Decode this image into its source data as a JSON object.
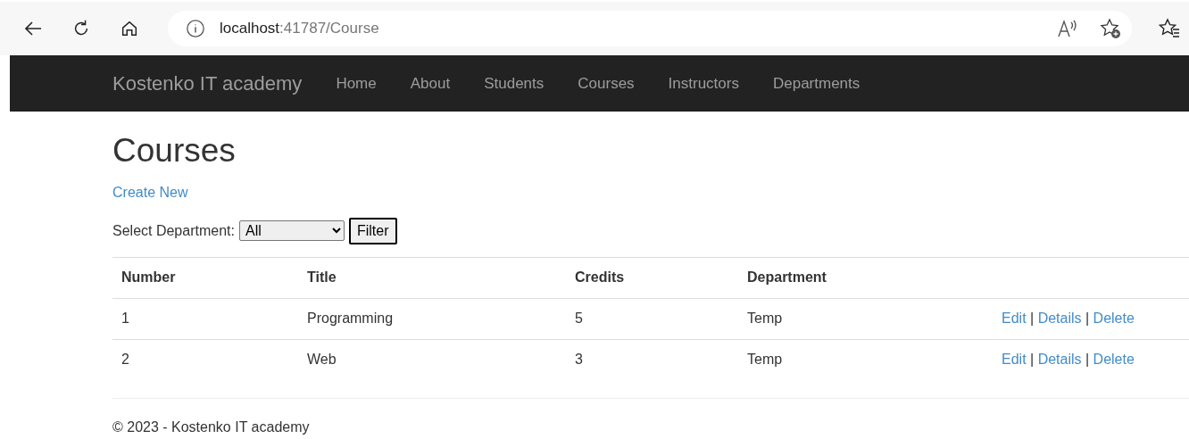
{
  "browser": {
    "url_host": "localhost",
    "url_path": ":41787/Course"
  },
  "navbar": {
    "brand": "Kostenko IT academy",
    "items": [
      "Home",
      "About",
      "Students",
      "Courses",
      "Instructors",
      "Departments"
    ]
  },
  "page": {
    "title": "Courses",
    "create_link": "Create New",
    "filter": {
      "label": "Select Department:",
      "value": "All",
      "button": "Filter"
    }
  },
  "table": {
    "columns": [
      "Number",
      "Title",
      "Credits",
      "Department"
    ],
    "rows": [
      {
        "cells": [
          "1",
          "Programming",
          "5",
          "Temp"
        ],
        "actions": [
          "Edit",
          "Details",
          "Delete"
        ],
        "separators": [
          "|",
          "|"
        ]
      },
      {
        "cells": [
          "2",
          "Web",
          "3",
          "Temp"
        ],
        "actions": [
          "Edit",
          "Details",
          "Delete"
        ],
        "separators": [
          "|",
          "|"
        ]
      }
    ]
  },
  "footer": "© 2023 - Kostenko IT academy"
}
